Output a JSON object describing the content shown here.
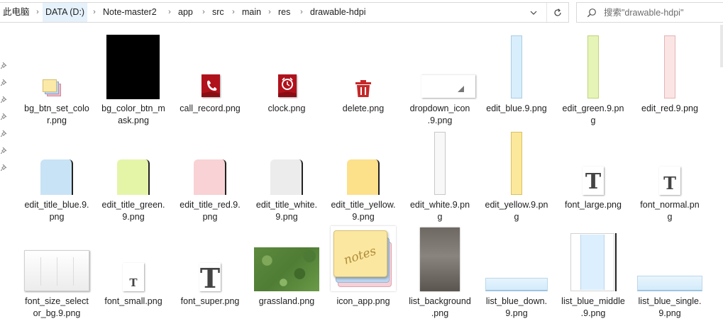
{
  "breadcrumb": {
    "items": [
      "此电脑",
      "DATA (D:)",
      "Note-master2",
      "app",
      "src",
      "main",
      "res",
      "drawable-hdpi"
    ],
    "active_index": 1
  },
  "search": {
    "placeholder": "搜索\"drawable-hdpi\""
  },
  "icons": {
    "address_dropdown": "chevron-down-icon",
    "refresh": "refresh-icon",
    "search": "search-icon",
    "pin": "pin-icon"
  },
  "files": [
    {
      "name": "bg_btn_set_color.png",
      "label_lines": [
        "bg_btn_set_colo",
        "r.png"
      ],
      "icon": "stacked-cards"
    },
    {
      "name": "bg_color_btn_mask.png",
      "label_lines": [
        "bg_color_btn_m",
        "ask.png"
      ],
      "icon": "black-mask"
    },
    {
      "name": "call_record.png",
      "label_lines": [
        "call_record.png"
      ],
      "icon": "phone-icon"
    },
    {
      "name": "clock.png",
      "label_lines": [
        "clock.png"
      ],
      "icon": "clock-icon"
    },
    {
      "name": "delete.png",
      "label_lines": [
        "delete.png"
      ],
      "icon": "trash-icon"
    },
    {
      "name": "dropdown_icon.9.png",
      "label_lines": [
        "dropdown_icon",
        ".9.png"
      ],
      "icon": "dropdown-corner"
    },
    {
      "name": "edit_blue.9.png",
      "label_lines": [
        "edit_blue.9.png"
      ],
      "icon": "strip-blue"
    },
    {
      "name": "edit_green.9.png",
      "label_lines": [
        "edit_green.9.pn",
        "g"
      ],
      "icon": "strip-green"
    },
    {
      "name": "edit_red.9.png",
      "label_lines": [
        "edit_red.9.png"
      ],
      "icon": "strip-red"
    },
    {
      "name": "edit_title_blue.9.png",
      "label_lines": [
        "edit_title_blue.9.",
        "png"
      ],
      "icon": "title-blue"
    },
    {
      "name": "edit_title_green.9.png",
      "label_lines": [
        "edit_title_green.",
        "9.png"
      ],
      "icon": "title-green"
    },
    {
      "name": "edit_title_red.9.png",
      "label_lines": [
        "edit_title_red.9.",
        "png"
      ],
      "icon": "title-red"
    },
    {
      "name": "edit_title_white.9.png",
      "label_lines": [
        "edit_title_white.",
        "9.png"
      ],
      "icon": "title-white"
    },
    {
      "name": "edit_title_yellow.9.png",
      "label_lines": [
        "edit_title_yellow.",
        "9.png"
      ],
      "icon": "title-yellow"
    },
    {
      "name": "edit_white.9.png",
      "label_lines": [
        "edit_white.9.pn",
        "g"
      ],
      "icon": "strip-white"
    },
    {
      "name": "edit_yellow.9.png",
      "label_lines": [
        "edit_yellow.9.pn",
        "g"
      ],
      "icon": "strip-yellow"
    },
    {
      "name": "font_large.png",
      "label_lines": [
        "font_large.png"
      ],
      "icon": "font-T-large",
      "glyph": "T"
    },
    {
      "name": "font_normal.png",
      "label_lines": [
        "font_normal.pn",
        "g"
      ],
      "icon": "font-T-normal",
      "glyph": "T"
    },
    {
      "name": "font_size_selector_bg.9.png",
      "label_lines": [
        "font_size_select",
        "or_bg.9.png"
      ],
      "icon": "selector-bg"
    },
    {
      "name": "font_small.png",
      "label_lines": [
        "font_small.png"
      ],
      "icon": "font-T-small",
      "glyph": "T"
    },
    {
      "name": "font_super.png",
      "label_lines": [
        "font_super.png"
      ],
      "icon": "font-T-super",
      "glyph": "T"
    },
    {
      "name": "grassland.png",
      "label_lines": [
        "grassland.png"
      ],
      "icon": "grass-texture"
    },
    {
      "name": "icon_app.png",
      "label_lines": [
        "icon_app.png"
      ],
      "icon": "notes-app-icon",
      "glyph": "notes"
    },
    {
      "name": "list_background.png",
      "label_lines": [
        "list_background",
        ".png"
      ],
      "icon": "gray-gradient"
    },
    {
      "name": "list_blue_down.9.png",
      "label_lines": [
        "list_blue_down.",
        "9.png"
      ],
      "icon": "blue-bar-down"
    },
    {
      "name": "list_blue_middle.9.png",
      "label_lines": [
        "list_blue_middle",
        ".9.png"
      ],
      "icon": "blue-middle"
    },
    {
      "name": "list_blue_single.9.png",
      "label_lines": [
        "list_blue_single.",
        "9.png"
      ],
      "icon": "blue-bar-single"
    }
  ]
}
